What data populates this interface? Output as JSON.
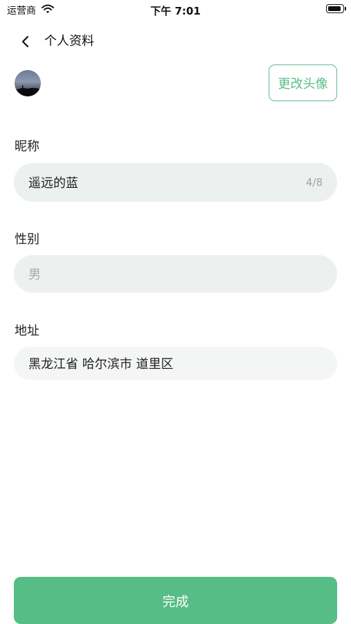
{
  "status_bar": {
    "carrier": "运营商",
    "time": "下午 7:01",
    "wifi_icon": "wifi-icon",
    "battery_icon": "battery-icon"
  },
  "nav": {
    "title": "个人资料",
    "back_icon": "chevron-left-icon"
  },
  "avatar": {
    "change_label": "更改头像"
  },
  "form": {
    "nickname": {
      "label": "昵称",
      "value": "遥远的蓝",
      "counter": "4/8"
    },
    "gender": {
      "label": "性别",
      "placeholder": "男"
    },
    "address": {
      "label": "地址",
      "value": "黑龙江省 哈尔滨市 道里区"
    }
  },
  "actions": {
    "done_label": "完成"
  },
  "colors": {
    "accent": "#57bd87",
    "field_bg": "#ecf1f0"
  }
}
